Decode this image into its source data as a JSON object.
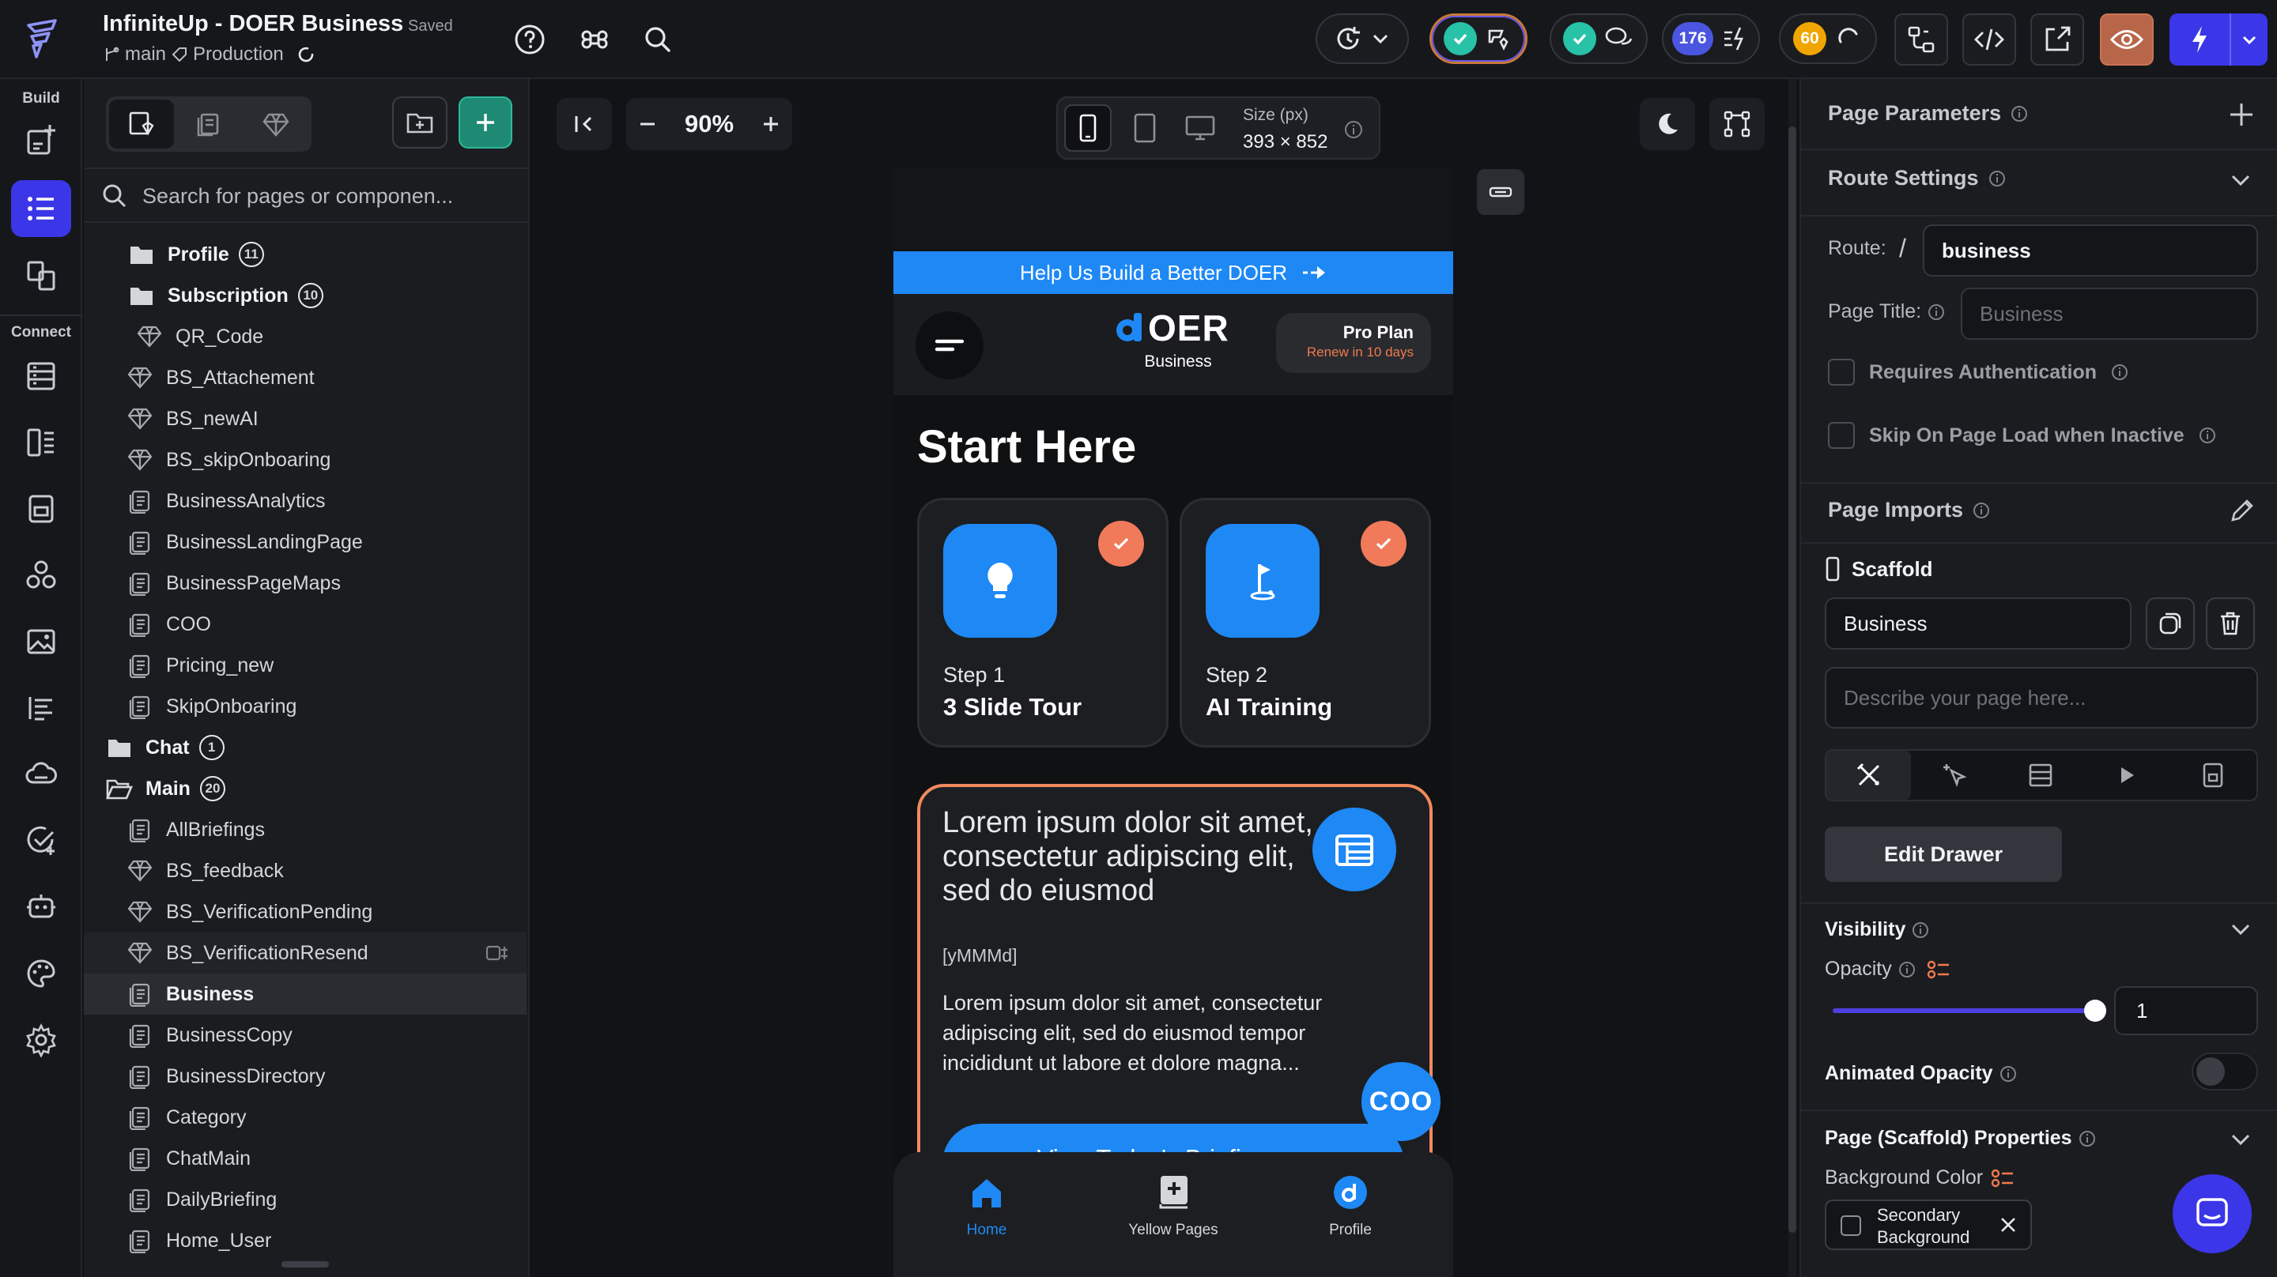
{
  "app": {
    "title": "InfiniteUp - DOER Business",
    "saved": "Saved",
    "branch": "main",
    "environment": "Production"
  },
  "toolbar": {
    "count_badge": "176",
    "warning_badge": "60"
  },
  "rail": {
    "build_label": "Build",
    "connect_label": "Connect"
  },
  "tree": {
    "search_placeholder": "Search for pages or componen...",
    "items": [
      {
        "label": "Profile",
        "type": "folder",
        "count": "11"
      },
      {
        "label": "Subscription",
        "type": "folder",
        "count": "10"
      },
      {
        "label": "QR_Code",
        "type": "component"
      },
      {
        "label": "BS_Attachement",
        "type": "component"
      },
      {
        "label": "BS_newAI",
        "type": "component"
      },
      {
        "label": "BS_skipOnboaring",
        "type": "component"
      },
      {
        "label": "BusinessAnalytics",
        "type": "page"
      },
      {
        "label": "BusinessLandingPage",
        "type": "page"
      },
      {
        "label": "BusinessPageMaps",
        "type": "page"
      },
      {
        "label": "COO",
        "type": "page"
      },
      {
        "label": "Pricing_new",
        "type": "page"
      },
      {
        "label": "SkipOnboaring",
        "type": "page"
      },
      {
        "label": "Chat",
        "type": "folder",
        "count": "1"
      },
      {
        "label": "Main",
        "type": "folder-open",
        "count": "20"
      },
      {
        "label": "AllBriefings",
        "type": "page"
      },
      {
        "label": "BS_feedback",
        "type": "component"
      },
      {
        "label": "BS_VerificationPending",
        "type": "component"
      },
      {
        "label": "BS_VerificationResend",
        "type": "component"
      },
      {
        "label": "Business",
        "type": "page"
      },
      {
        "label": "BusinessCopy",
        "type": "page"
      },
      {
        "label": "BusinessDirectory",
        "type": "page"
      },
      {
        "label": "Category",
        "type": "page"
      },
      {
        "label": "ChatMain",
        "type": "page"
      },
      {
        "label": "DailyBriefing",
        "type": "page"
      },
      {
        "label": "Home_User",
        "type": "page"
      }
    ]
  },
  "canvas": {
    "zoom": "90%",
    "size_label": "Size (px)",
    "size_value": "393 × 852"
  },
  "phone": {
    "banner": "Help Us Build a Better DOER",
    "logo_text": "OER",
    "logo_sub": "Business",
    "plan_title": "Pro Plan",
    "plan_sub": "Renew in 10 days",
    "heading": "Start Here",
    "steps": [
      {
        "step": "Step 1",
        "title": "3 Slide Tour"
      },
      {
        "step": "Step 2",
        "title": "AI Training"
      }
    ],
    "card_title": "Lorem ipsum dolor sit amet, consectetur adipiscing elit, sed do eiusmod",
    "card_date": "[yMMMd]",
    "card_body": "Lorem ipsum dolor sit amet, consectetur adipiscing elit, sed do eiusmod tempor incididunt ut labore et dolore magna...",
    "card_button": "View Today's Briefing",
    "coo_badge": "COO",
    "nav": [
      "Home",
      "Yellow Pages",
      "Profile"
    ]
  },
  "props": {
    "page_parameters": "Page Parameters",
    "route_settings": "Route Settings",
    "route_label": "Route:",
    "route_slash": "/",
    "route_value": "business",
    "page_title_label": "Page Title:",
    "page_title_placeholder": "Business",
    "requires_auth": "Requires Authentication",
    "skip_on_load": "Skip On Page Load when Inactive",
    "page_imports": "Page Imports",
    "scaffold": "Scaffold",
    "scaffold_name": "Business",
    "describe_placeholder": "Describe your page here...",
    "edit_drawer": "Edit Drawer",
    "visibility": "Visibility",
    "opacity_label": "Opacity",
    "opacity_value": "1",
    "animated_opacity": "Animated Opacity",
    "scaffold_props": "Page (Scaffold) Properties",
    "bg_color_label": "Background Color",
    "bg_color_value_1": "Secondary",
    "bg_color_value_2": "Background"
  },
  "colors": {
    "accent_blue": "#2f6bf6",
    "teal": "#27c2a8",
    "orange": "#f0a500",
    "phone_blue": "#1e88f5"
  }
}
